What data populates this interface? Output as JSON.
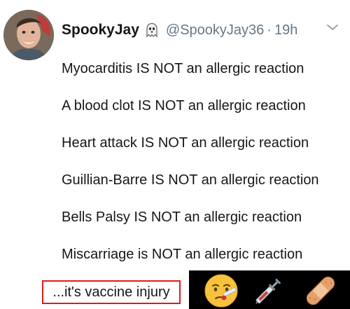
{
  "tweet": {
    "display_name": "SpookyJay",
    "handle": "@SpookyJay36",
    "separator": "·",
    "time": "19h",
    "lines": [
      "Myocarditis IS NOT an allergic reaction",
      "A blood clot IS NOT an allergic reaction",
      "Heart attack IS NOT an allergic reaction",
      "Guillian-Barre IS NOT an allergic reaction",
      "Bells Palsy IS NOT an allergic reaction",
      "Miscarriage is NOT an allergic reaction"
    ]
  },
  "caption": {
    "text": "...it's vaccine injury"
  },
  "emojis": [
    "face-with-thermometer-icon",
    "syringe-icon",
    "adhesive-bandage-icon"
  ],
  "colors": {
    "text_primary": "#14171a",
    "text_secondary": "#657786",
    "highlight_box": "#e01b1b",
    "footer_background": "#000000"
  }
}
